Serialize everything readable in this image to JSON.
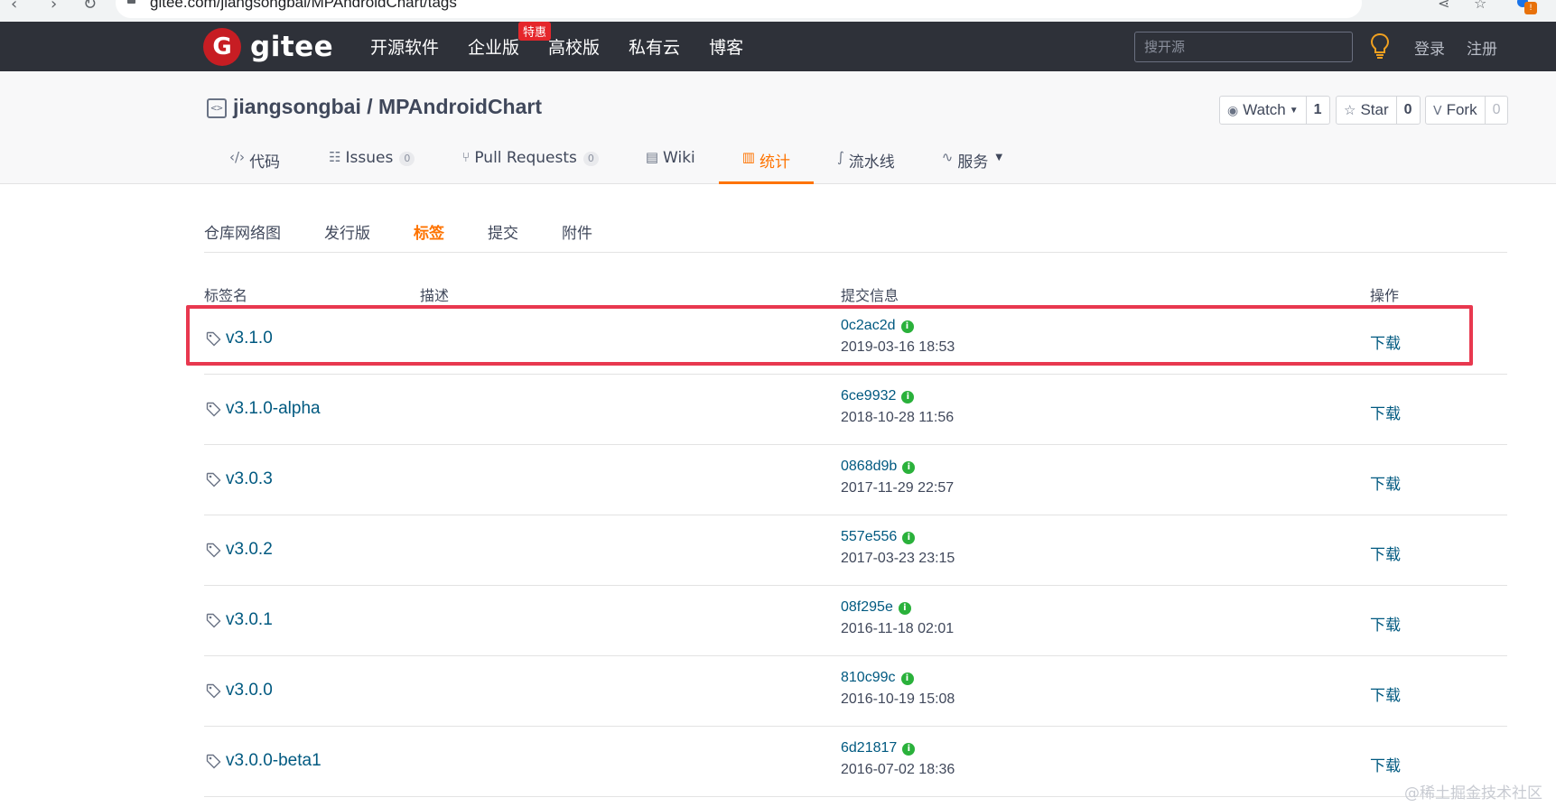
{
  "browser": {
    "url": "gitee.com/jiangsongbai/MPAndroidChart/tags"
  },
  "header": {
    "logo_glyph": "G",
    "logo_text": "gitee",
    "nav": [
      {
        "label": "开源软件"
      },
      {
        "label": "企业版",
        "badge": "特惠"
      },
      {
        "label": "高校版"
      },
      {
        "label": "私有云"
      },
      {
        "label": "博客"
      }
    ],
    "search_placeholder": "搜开源",
    "login": "登录",
    "register": "注册"
  },
  "repo": {
    "title": "jiangsongbai / MPAndroidChart",
    "watch_label": "Watch",
    "watch_count": "1",
    "star_label": "Star",
    "star_count": "0",
    "fork_label": "Fork",
    "fork_count": "0"
  },
  "project_tabs": [
    {
      "label": "代码",
      "icon": "code-icon"
    },
    {
      "label": "Issues",
      "count": "0",
      "icon": "issues-icon"
    },
    {
      "label": "Pull Requests",
      "count": "0",
      "icon": "pull-request-icon"
    },
    {
      "label": "Wiki",
      "icon": "book-icon"
    },
    {
      "label": "统计",
      "icon": "bar-chart-icon",
      "active": true
    },
    {
      "label": "流水线",
      "icon": "pipeline-icon"
    },
    {
      "label": "服务",
      "icon": "pulse-icon",
      "dropdown": true
    }
  ],
  "sub_tabs": [
    {
      "label": "仓库网络图"
    },
    {
      "label": "发行版"
    },
    {
      "label": "标签",
      "active": true
    },
    {
      "label": "提交"
    },
    {
      "label": "附件"
    }
  ],
  "table": {
    "headers": {
      "name": "标签名",
      "desc": "描述",
      "commit": "提交信息",
      "action": "操作"
    },
    "rows": [
      {
        "tag": "v3.1.0",
        "commit": "0c2ac2d",
        "date": "2019-03-16 18:53",
        "action": "下载"
      },
      {
        "tag": "v3.1.0-alpha",
        "commit": "6ce9932",
        "date": "2018-10-28 11:56",
        "action": "下载"
      },
      {
        "tag": "v3.0.3",
        "commit": "0868d9b",
        "date": "2017-11-29 22:57",
        "action": "下载"
      },
      {
        "tag": "v3.0.2",
        "commit": "557e556",
        "date": "2017-03-23 23:15",
        "action": "下载"
      },
      {
        "tag": "v3.0.1",
        "commit": "08f295e",
        "date": "2016-11-18 02:01",
        "action": "下载"
      },
      {
        "tag": "v3.0.0",
        "commit": "810c99c",
        "date": "2016-10-19 15:08",
        "action": "下载"
      },
      {
        "tag": "v3.0.0-beta1",
        "commit": "6d21817",
        "date": "2016-07-02 18:36",
        "action": "下载"
      }
    ]
  },
  "info_glyph": "i",
  "watermark": "@稀土掘金技术社区",
  "colors": {
    "header_bg": "#2e3139",
    "brand_red": "#c71d23",
    "accent_orange": "#fe7300",
    "link_blue": "#005980",
    "highlight_red": "#e8384f",
    "info_green": "#2ab13b"
  }
}
